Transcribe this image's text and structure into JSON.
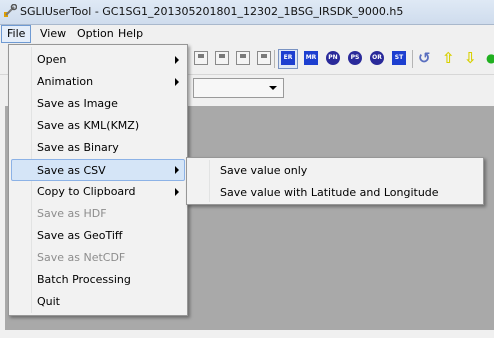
{
  "window": {
    "title": "SGLIUserTool - GC1SG1_201305201801_12302_1BSG_IRSDK_9000.h5",
    "icon": "app-wrench-icon"
  },
  "menubar": {
    "items": [
      "File",
      "View",
      "Option",
      "Help"
    ]
  },
  "toolbar": {
    "buttons": [
      "ER",
      "MR",
      "PN",
      "PS",
      "OR",
      "ST"
    ],
    "icons": [
      "undo-arrow-icon",
      "up-arrow-icon",
      "down-arrow-icon"
    ],
    "colors": {
      "blue": "#1d3fd0",
      "arrow_yellow": "#e8e800",
      "arrow_green": "#20b020"
    }
  },
  "file_menu": {
    "items": [
      {
        "label": "Open",
        "submenu": true,
        "enabled": true
      },
      {
        "label": "Animation",
        "submenu": true,
        "enabled": true
      },
      {
        "label": "Save as Image",
        "submenu": false,
        "enabled": true
      },
      {
        "label": "Save as KML(KMZ)",
        "submenu": false,
        "enabled": true
      },
      {
        "label": "Save as Binary",
        "submenu": false,
        "enabled": true
      },
      {
        "label": "Save as CSV",
        "submenu": true,
        "enabled": true,
        "highlighted": true
      },
      {
        "label": "Copy to Clipboard",
        "submenu": true,
        "enabled": true
      },
      {
        "label": "Save as HDF",
        "submenu": false,
        "enabled": false
      },
      {
        "label": "Save as GeoTiff",
        "submenu": false,
        "enabled": true
      },
      {
        "label": "Save as NetCDF",
        "submenu": false,
        "enabled": false
      },
      {
        "label": "Batch Processing",
        "submenu": false,
        "enabled": true
      },
      {
        "label": "Quit",
        "submenu": false,
        "enabled": true
      }
    ]
  },
  "csv_submenu": {
    "items": [
      "Save value only",
      "Save value with Latitude and Longitude"
    ]
  },
  "colors": {
    "highlight": "#d5e5f7",
    "highlight_border": "#8cb2e6",
    "workarea": "#a9a9a9"
  }
}
